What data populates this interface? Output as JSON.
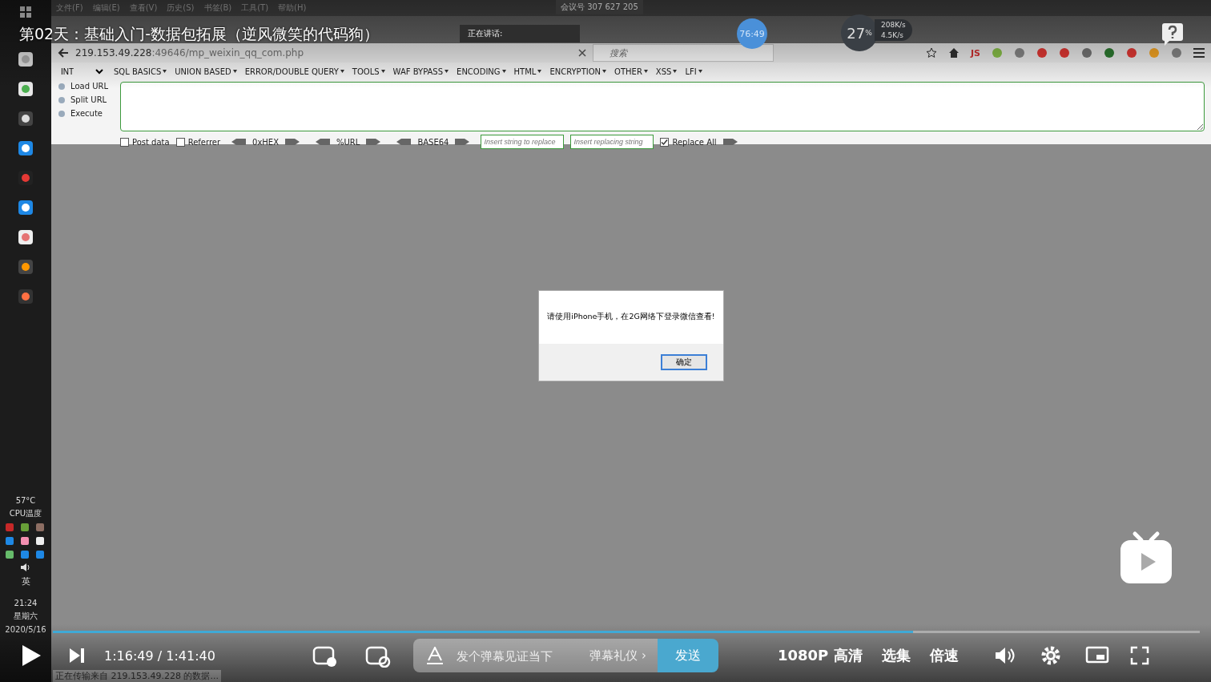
{
  "taskbar": {
    "temperature": "57°C",
    "sensor": "CPU温度",
    "ime": "英",
    "time": "21:24",
    "day": "星期六",
    "date": "2020/5/16"
  },
  "browser": {
    "menu": [
      "文件(F)",
      "编辑(E)",
      "查看(V)",
      "历史(S)",
      "书签(B)",
      "工具(T)",
      "帮助(H)"
    ],
    "url_host": "219.153.49.228",
    "url_rest": ":49646/mp_weixin_qq_com.php",
    "search": {
      "placeholder": "搜索"
    },
    "js_button": "JS",
    "status": "正在传输来自 219.153.49.228 的数据..."
  },
  "hackbar": {
    "select": "INT",
    "menus": [
      "SQL BASICS",
      "UNION BASED",
      "ERROR/DOUBLE QUERY",
      "TOOLS",
      "WAF BYPASS",
      "ENCODING",
      "HTML",
      "ENCRYPTION",
      "OTHER",
      "XSS",
      "LFI"
    ],
    "actions": [
      "Load URL",
      "Split URL",
      "Execute"
    ],
    "options": [
      {
        "label": "Post data",
        "checked": false
      },
      {
        "label": "Referrer",
        "checked": false
      }
    ],
    "encoders": [
      "0xHEX",
      "%URL",
      "BASE64"
    ],
    "replace_fields": [
      {
        "placeholder": "Insert string to replace"
      },
      {
        "placeholder": "Insert replacing string"
      }
    ],
    "replace_all": {
      "label": "Replace All",
      "checked": true
    }
  },
  "dialog": {
    "message": "请使用iPhone手机，在2G网络下登录微信查看!",
    "ok": "确定"
  },
  "overlays": {
    "meeting": "会议号 307 627 205",
    "speaking": "正在讲话:",
    "timer": "76:49",
    "load": "27",
    "load_unit": "%",
    "upload": "208K/s",
    "download": "4.5K/s"
  },
  "video": {
    "title": "第02天：基础入门-数据包拓展（逆风微笑的代码狗）",
    "progress": {
      "level": 0.75
    },
    "current_time": "1:16:49",
    "separator": "/",
    "total_time": "1:41:40",
    "danmaku": {
      "placeholder": "发个弹幕见证当下",
      "etiquette": "弹幕礼仪 ›",
      "send": "发送"
    },
    "quality": "1080P 高清",
    "episodes": "选集",
    "speed": "倍速"
  }
}
